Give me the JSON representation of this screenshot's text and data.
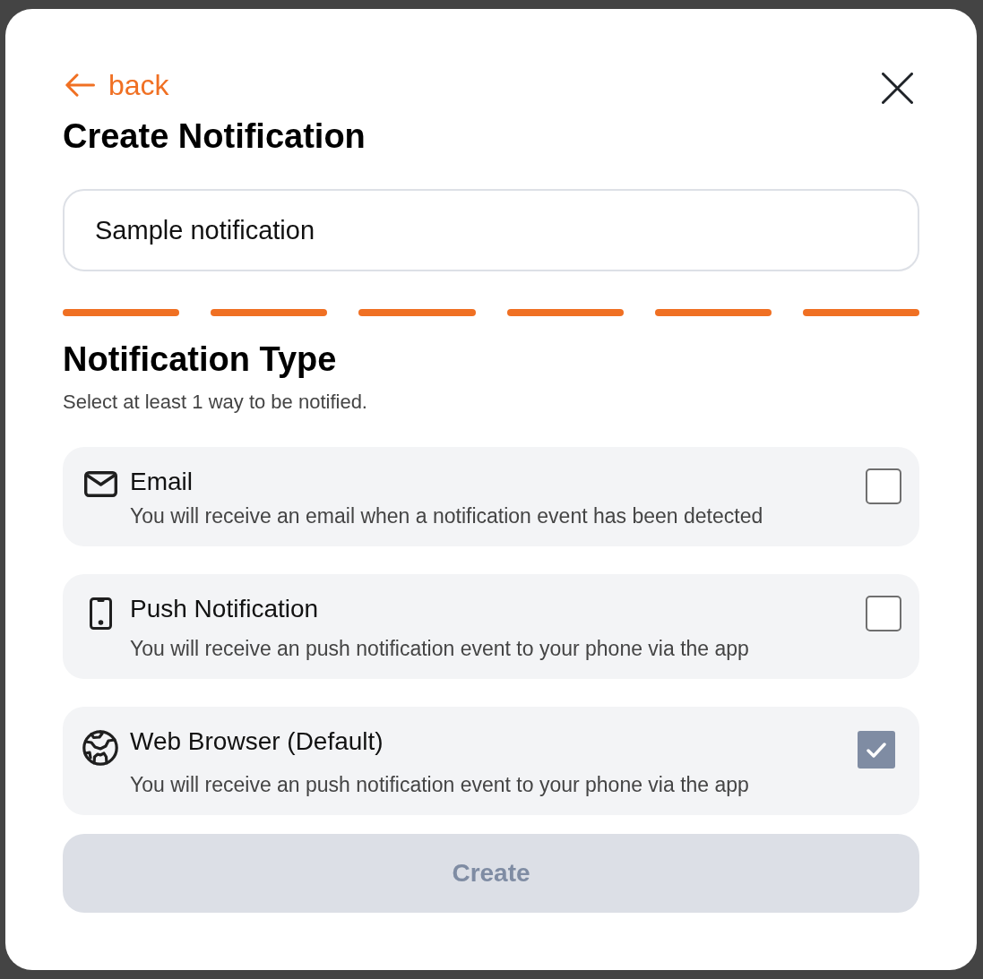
{
  "back_link": {
    "label": "back"
  },
  "title": "Create Notification",
  "name_field": {
    "value": "Sample notification"
  },
  "progress": [
    {
      "complete": true
    },
    {
      "complete": true
    },
    {
      "complete": true
    },
    {
      "complete": true
    },
    {
      "complete": true
    },
    {
      "complete": true
    }
  ],
  "section": {
    "title": "Notification Type",
    "subtitle": "Select at least 1 way to be notified."
  },
  "options": [
    {
      "kind": "email",
      "title": "Email",
      "description": "You will receive an email when a notification event has been detected",
      "checked": false
    },
    {
      "kind": "phone",
      "title": "Push Notification",
      "description": "You will receive an push notification event to your phone via the app",
      "checked": false
    },
    {
      "kind": "browser",
      "title": "Web Browser (Default)",
      "description": "You will receive an push notification event to your phone via the app",
      "checked": true
    }
  ],
  "create_button": {
    "label": "Create",
    "disabled": true
  }
}
